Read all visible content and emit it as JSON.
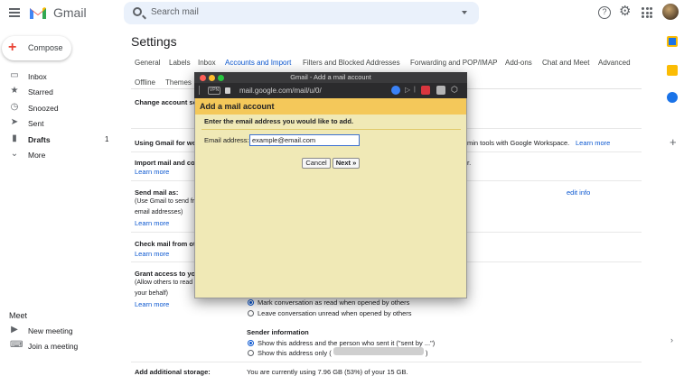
{
  "header": {
    "logo_text": "Gmail",
    "search_placeholder": "Search mail"
  },
  "compose": {
    "label": "Compose"
  },
  "nav": [
    {
      "label": "Inbox",
      "icon": "inbox-icon",
      "count": ""
    },
    {
      "label": "Starred",
      "icon": "star-icon",
      "count": ""
    },
    {
      "label": "Snoozed",
      "icon": "clock-icon",
      "count": ""
    },
    {
      "label": "Sent",
      "icon": "send-icon",
      "count": ""
    },
    {
      "label": "Drafts",
      "icon": "draft-icon",
      "count": "1"
    },
    {
      "label": "More",
      "icon": "chevron-down-icon",
      "count": ""
    }
  ],
  "meet": {
    "title": "Meet",
    "new_meeting": "New meeting",
    "join_meeting": "Join a meeting"
  },
  "settings": {
    "title": "Settings",
    "tabs": [
      "General",
      "Labels",
      "Inbox",
      "Accounts and Import",
      "Filters and Blocked Addresses",
      "Forwarding and POP/IMAP",
      "Add-ons",
      "Chat and Meet",
      "Advanced",
      "Offline",
      "Themes"
    ],
    "active_tab": "Accounts and Import",
    "rows": {
      "change_account": "Change account se",
      "using_gmail": "Using Gmail for wo",
      "workspace_text": "min tools with Google Workspace.",
      "workspace_link": "Learn more",
      "import_mail": "Import mail and co",
      "import_suffix": "r.",
      "learn_more": "Learn more",
      "send_mail_as": "Send mail as:",
      "send_sub1": "(Use Gmail to send fr",
      "send_sub2": "email addresses)",
      "edit_info": "edit info",
      "check_mail": "Check mail from ot",
      "grant_access": "Grant access to yo",
      "grant_sub1": "(Allow others to read",
      "grant_sub2": "your behalf)",
      "mark_read": "Mark conversation as read when opened by others",
      "leave_unread": "Leave conversation unread when opened by others",
      "sender_info": "Sender information",
      "show_both": "Show this address and the person who sent it (\"sent by ...\")",
      "show_only": "Show this address only (",
      "show_only_end": ")",
      "add_storage": "Add additional storage:",
      "storage_text": "You are currently using 7.96 GB (53%) of your 15 GB."
    }
  },
  "dialog": {
    "window_title": "Gmail - Add a mail account",
    "url": "mail.google.com/mail/u/0/",
    "vpn": "VPN",
    "heading": "Add a mail account",
    "instruction": "Enter the email address you would like to add.",
    "email_label": "Email address:",
    "email_value": "example@email.com",
    "cancel_label": "Cancel",
    "next_label": "Next »"
  },
  "colors": {
    "accent": "#0b57d0",
    "dialog_bg": "#f0e9b6",
    "dialog_header": "#f4c85a"
  }
}
